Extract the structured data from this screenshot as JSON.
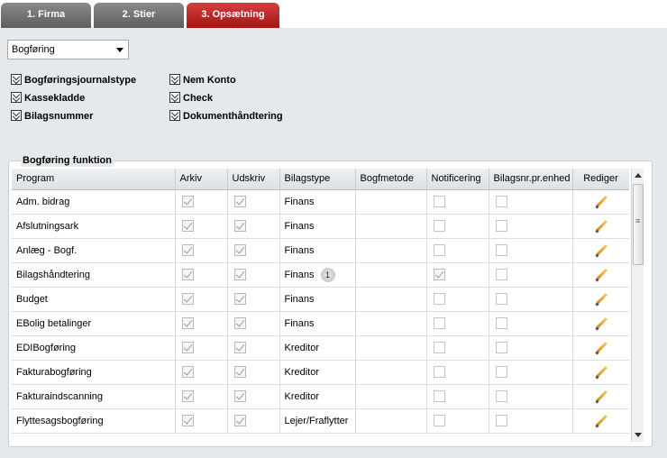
{
  "tabs": [
    {
      "label": "1. Firma"
    },
    {
      "label": "2. Stier"
    },
    {
      "label": "3. Opsætning"
    }
  ],
  "dropdown": {
    "selected": "Bogføring"
  },
  "sections": [
    {
      "label": "Bogføringsjournalstype"
    },
    {
      "label": "Kassekladde"
    },
    {
      "label": "Bilagsnummer"
    },
    {
      "label": "Nem Konto"
    },
    {
      "label": "Check"
    },
    {
      "label": "Dokumenthåndtering"
    }
  ],
  "grid": {
    "legend": "Bogføring funktion",
    "columns": [
      "Program",
      "Arkiv",
      "Udskriv",
      "Bilagstype",
      "Bogfmetode",
      "Notificering",
      "Bilagsnr.pr.enhed",
      "Rediger"
    ],
    "rows": [
      {
        "program": "Adm. bidrag",
        "arkiv": true,
        "udskriv": true,
        "bilagstype": "Finans",
        "badge": "",
        "bogfmetode": "",
        "notificering": false,
        "bilagsnr": false
      },
      {
        "program": "Afslutningsark",
        "arkiv": true,
        "udskriv": true,
        "bilagstype": "Finans",
        "badge": "",
        "bogfmetode": "",
        "notificering": false,
        "bilagsnr": false
      },
      {
        "program": "Anlæg - Bogf.",
        "arkiv": true,
        "udskriv": true,
        "bilagstype": "Finans",
        "badge": "",
        "bogfmetode": "",
        "notificering": false,
        "bilagsnr": false
      },
      {
        "program": "Bilagshåndtering",
        "arkiv": true,
        "udskriv": true,
        "bilagstype": "Finans",
        "badge": "1",
        "bogfmetode": "",
        "notificering": true,
        "bilagsnr": false
      },
      {
        "program": "Budget",
        "arkiv": true,
        "udskriv": true,
        "bilagstype": "Finans",
        "badge": "",
        "bogfmetode": "",
        "notificering": false,
        "bilagsnr": false
      },
      {
        "program": "EBolig betalinger",
        "arkiv": true,
        "udskriv": true,
        "bilagstype": "Finans",
        "badge": "",
        "bogfmetode": "",
        "notificering": false,
        "bilagsnr": false
      },
      {
        "program": "EDIBogføring",
        "arkiv": true,
        "udskriv": true,
        "bilagstype": "Kreditor",
        "badge": "",
        "bogfmetode": "",
        "notificering": false,
        "bilagsnr": false
      },
      {
        "program": "Fakturabogføring",
        "arkiv": true,
        "udskriv": true,
        "bilagstype": "Kreditor",
        "badge": "",
        "bogfmetode": "",
        "notificering": false,
        "bilagsnr": false
      },
      {
        "program": "Fakturaindscanning",
        "arkiv": true,
        "udskriv": true,
        "bilagstype": "Kreditor",
        "badge": "",
        "bogfmetode": "",
        "notificering": false,
        "bilagsnr": false
      },
      {
        "program": "Flyttesagsbogføring",
        "arkiv": true,
        "udskriv": true,
        "bilagstype": "Lejer/Fraflytter",
        "badge": "",
        "bogfmetode": "",
        "notificering": false,
        "bilagsnr": false
      }
    ]
  }
}
